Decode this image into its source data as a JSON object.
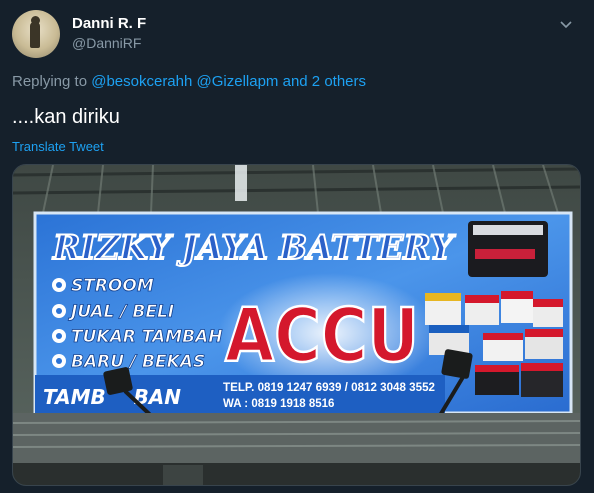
{
  "tweet": {
    "author_name": "Danni R. F",
    "author_handle": "@DanniRF",
    "reply_prefix": "Replying to",
    "reply_mention_1": "@besokcerahh",
    "reply_mention_2": "@Gizellapm",
    "reply_suffix": "and 2 others",
    "text": "....kan diriku",
    "translate_label": "Translate Tweet"
  },
  "banner": {
    "shop_name": "RIZKY JAYA BATTERY",
    "service_1": "STROOM",
    "service_2": "JUAL / BELI",
    "service_3": "TUKAR TAMBAH",
    "service_4": "BARU / BEKAS",
    "headline": "ACCU",
    "tagline": "TAMB    BAN",
    "phone": "TELP. 0819 1247 6939 / 0812 3048 3552",
    "whatsapp": "WA : 0819 1918 8516"
  },
  "colors": {
    "background": "#15202b",
    "accent": "#1da1f2",
    "muted": "#8899a6",
    "banner_blue": "#1e5fc2",
    "headline_red": "#d4182c"
  }
}
